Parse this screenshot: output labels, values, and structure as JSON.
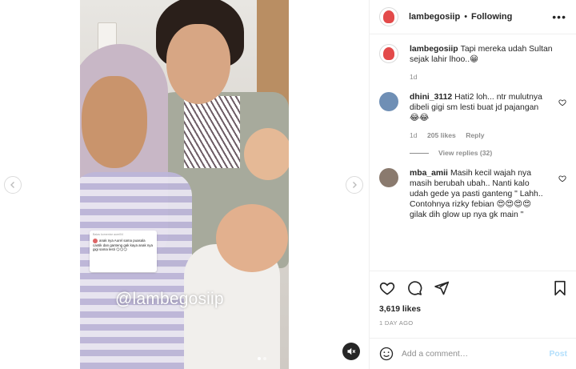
{
  "media": {
    "watermark": "@lambegosiip",
    "sticker_header": "Balas komentar aurel04",
    "sticker_text": "anak nya Aurel sama puasala cantik dan ganteng gak kaya anak nya gigi sama lesti 😏😏😏",
    "carousel_dots": 2
  },
  "header": {
    "username": "lambegosiip",
    "separator": "•",
    "follow_status": "Following",
    "more": "•••"
  },
  "caption": {
    "username": "lambegosiip",
    "text": "Tapi mereka udah Sultan sejak lahir lhoo..😁",
    "time": "1d"
  },
  "comments": [
    {
      "username": "dhini_3112",
      "text": "Hati2 loh... ntr mulutnya dibeli gigi sm lesti buat jd pajangan 😂😂",
      "time": "1d",
      "likes": "205 likes",
      "reply": "Reply",
      "view_replies": "View replies (32)",
      "avatar_color": "#6f8fb5"
    },
    {
      "username": "mba_amii",
      "text": "Masih kecil wajah nya masih berubah ubah.. Nanti kalo udah gede ya pasti ganteng \" Lahh.. Contohnya rizky febian 😍😍😍😍 gilak dih glow up nya gk main \"",
      "avatar_color": "#8a7a6e"
    }
  ],
  "post": {
    "likes": "3,619 likes",
    "time_ago": "1 DAY AGO"
  },
  "add_comment": {
    "placeholder": "Add a comment…",
    "post_label": "Post"
  },
  "colors": {
    "accent_post_disabled": "#b2dffc",
    "muted_text": "#8e8e8e",
    "border": "#efefef"
  }
}
